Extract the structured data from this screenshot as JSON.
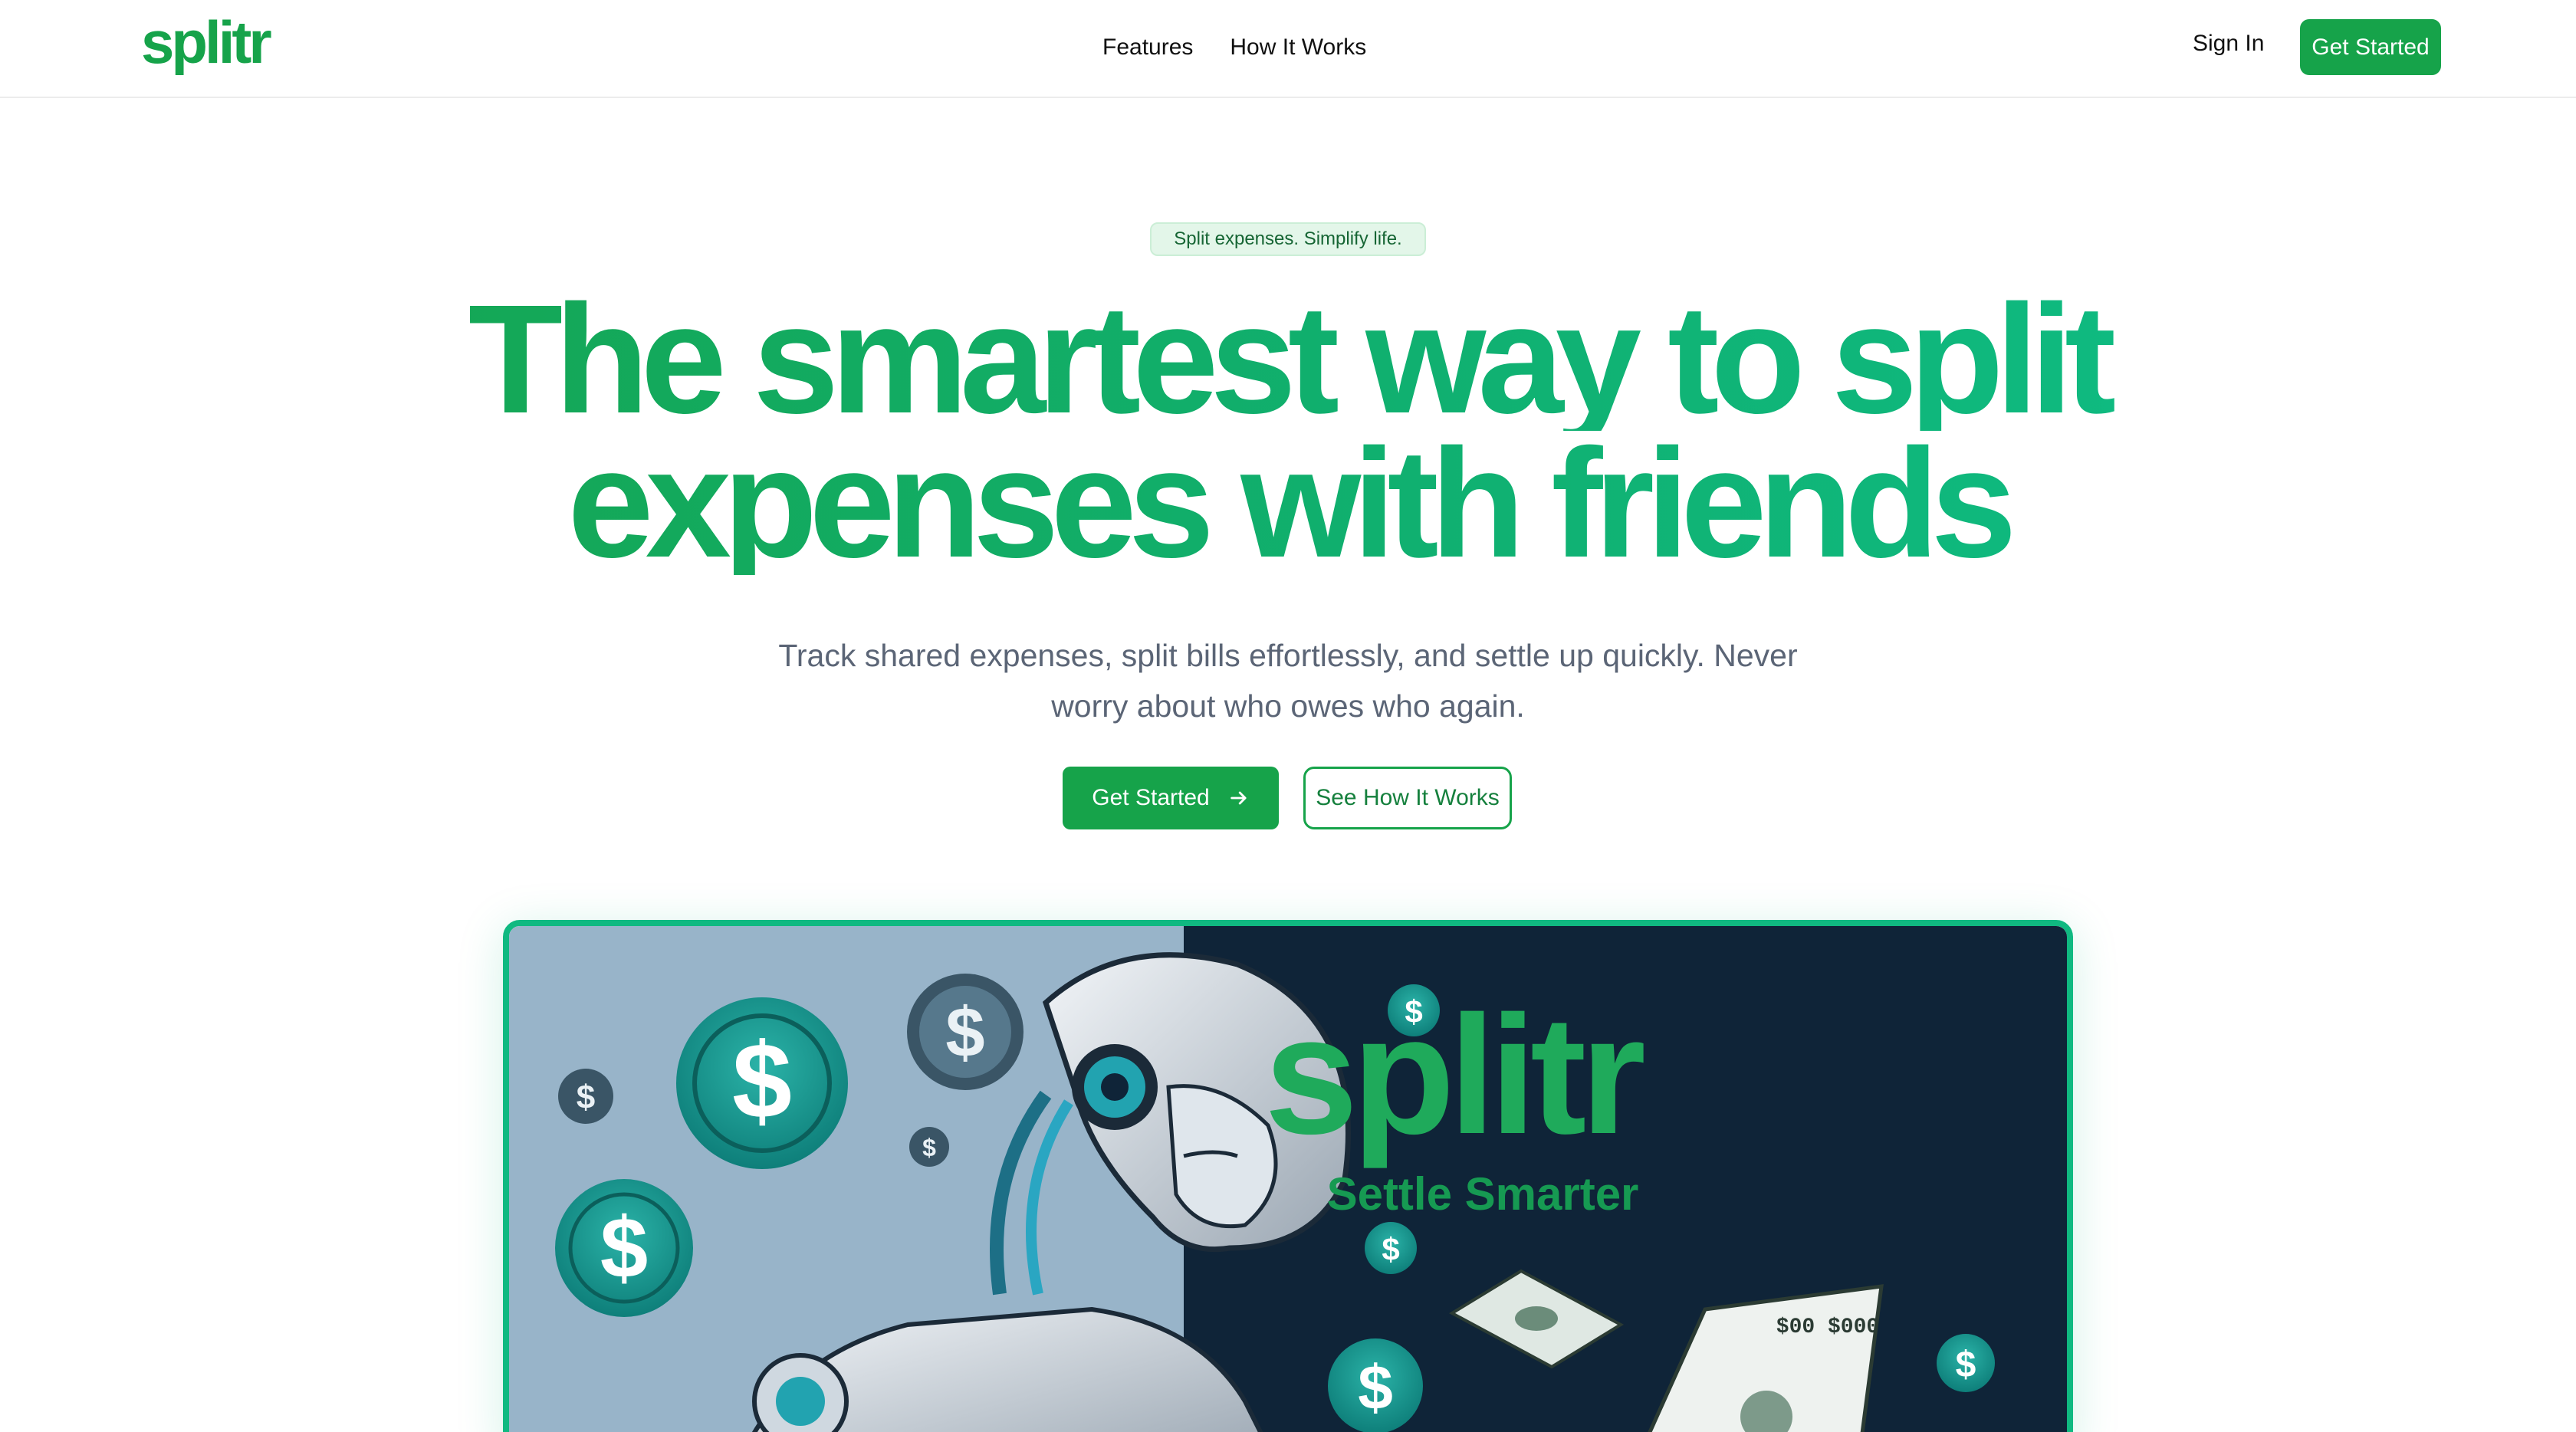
{
  "header": {
    "logo_text": "splitr",
    "nav": [
      "Features",
      "How It Works"
    ],
    "sign_in": "Sign In",
    "cta": "Get Started"
  },
  "hero": {
    "badge": "Split expenses. Simplify life.",
    "headline_line1": "The smartest way to split",
    "headline_line2": "expenses with friends",
    "subtitle": "Track shared expenses, split bills effortlessly, and settle up quickly. Never worry about who owes who again.",
    "primary_button": "Get Started",
    "secondary_button": "See How It Works"
  },
  "hero_image": {
    "brand": "splitr",
    "tagline": "Settle Smarter",
    "banknote_text": "$00 $000"
  },
  "colors": {
    "brand_green": "#16a34a",
    "accent_teal": "#10b981",
    "badge_bg": "#e3f6e9",
    "text_muted": "#5b6576"
  },
  "icons": [
    "arrow-right-icon",
    "dollar-coin-icon",
    "robot-illustration"
  ]
}
